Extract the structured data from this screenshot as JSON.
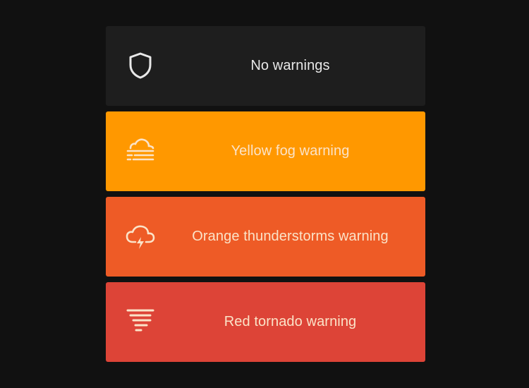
{
  "colors": {
    "background": "#111111",
    "none": "#1e1e1e",
    "yellow": "#ff9800",
    "orange": "#ee5b26",
    "red": "#dd4437"
  },
  "warnings": [
    {
      "level": "none",
      "label": "No warnings",
      "icon": "shield-icon"
    },
    {
      "level": "yellow",
      "label": "Yellow fog warning",
      "icon": "fog-icon"
    },
    {
      "level": "orange",
      "label": "Orange thunderstorms warning",
      "icon": "thunderstorm-icon"
    },
    {
      "level": "red",
      "label": "Red tornado warning",
      "icon": "tornado-icon"
    }
  ]
}
